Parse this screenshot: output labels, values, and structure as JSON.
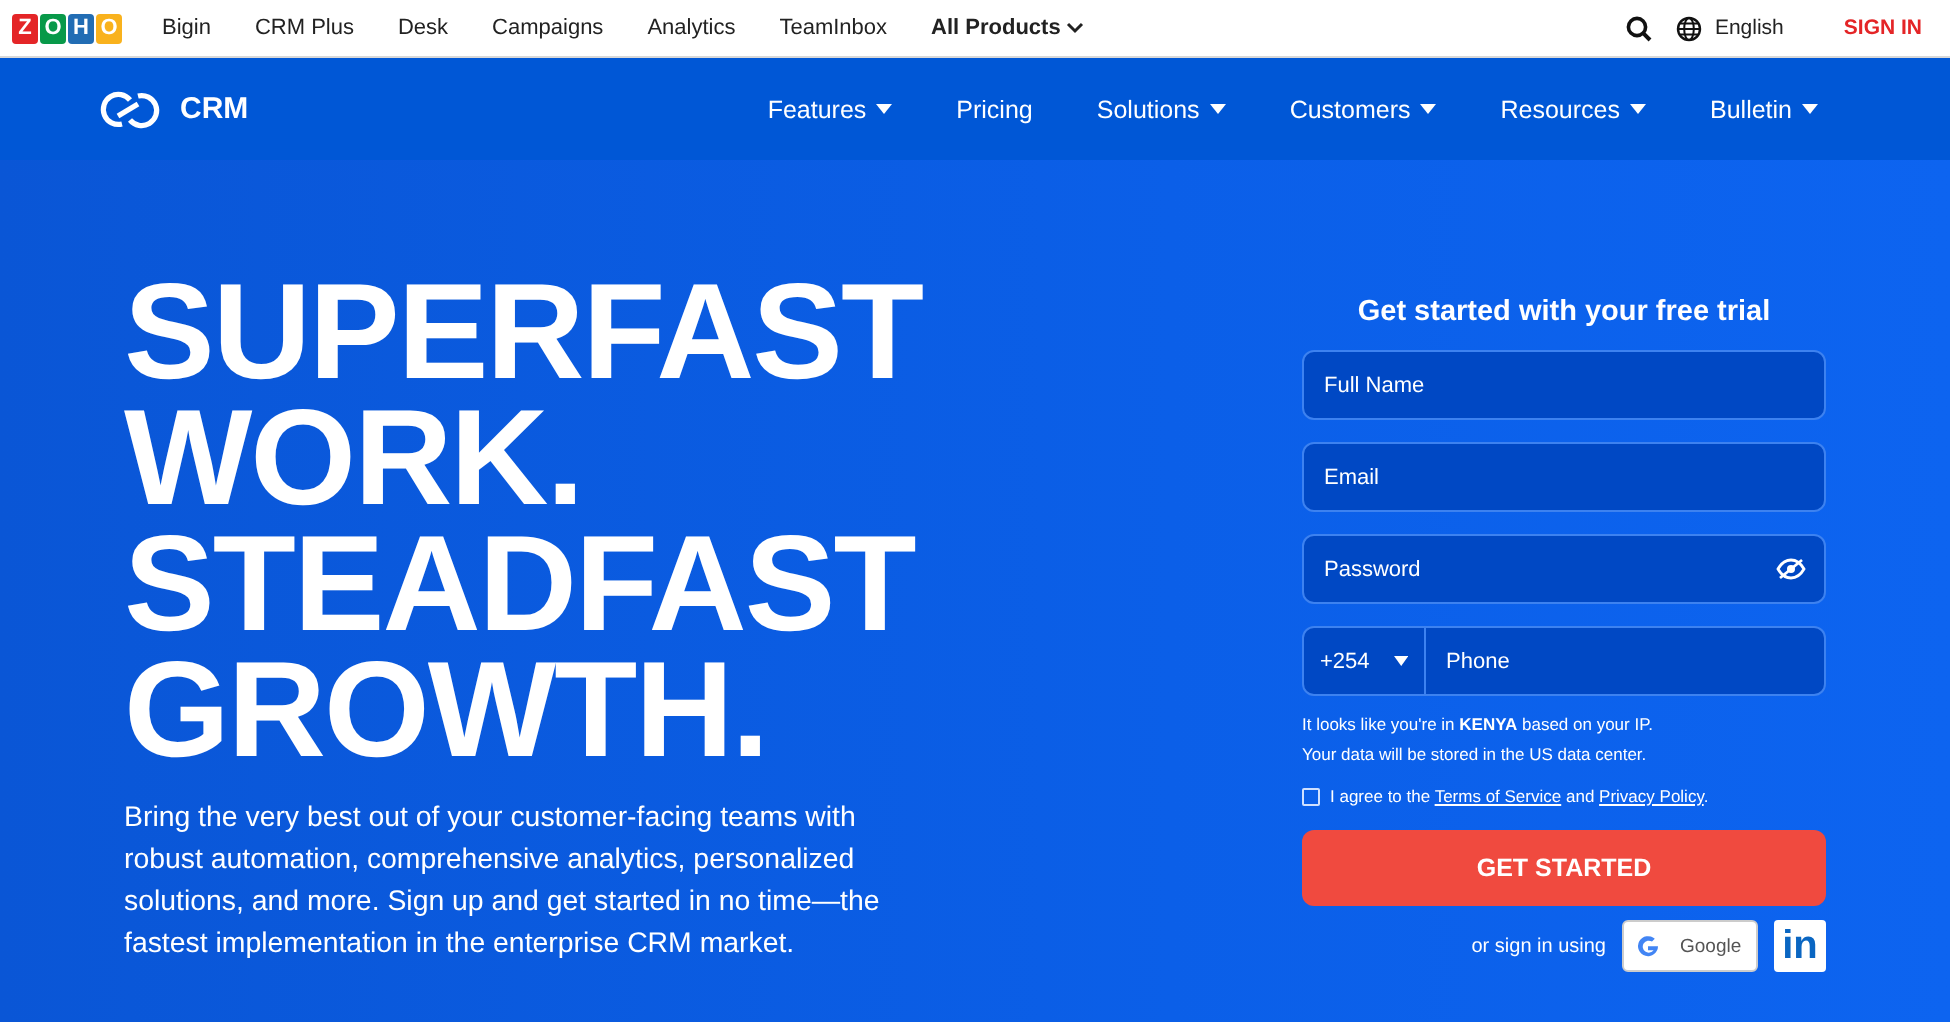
{
  "topbar": {
    "logo_letters": [
      "Z",
      "O",
      "H",
      "O"
    ],
    "links": [
      "Bigin",
      "CRM Plus",
      "Desk",
      "Campaigns",
      "Analytics",
      "TeamInbox"
    ],
    "all_products": "All Products",
    "language": "English",
    "sign_in": "SIGN IN"
  },
  "nav": {
    "brand": "CRM",
    "items": [
      {
        "label": "Features",
        "dropdown": true
      },
      {
        "label": "Pricing",
        "dropdown": false
      },
      {
        "label": "Solutions",
        "dropdown": true
      },
      {
        "label": "Customers",
        "dropdown": true
      },
      {
        "label": "Resources",
        "dropdown": true
      },
      {
        "label": "Bulletin",
        "dropdown": true
      }
    ]
  },
  "hero": {
    "headline": [
      "SUPERFAST",
      "WORK.",
      "STEADFAST",
      "GROWTH."
    ],
    "text": "Bring the very best out of your customer-facing teams with robust automation, comprehensive analytics, personalized solutions, and more. Sign up and get started in no time—the fastest implementation in the enterprise CRM market."
  },
  "form": {
    "title": "Get started with your free trial",
    "fields": [
      {
        "placeholder": "Full Name",
        "kind": "text"
      },
      {
        "placeholder": "Email",
        "kind": "text"
      },
      {
        "placeholder": "Password",
        "kind": "password"
      }
    ],
    "phone": {
      "code": "+254",
      "placeholder": "Phone"
    },
    "notes": [
      "It looks like you're in **KENYA** based on your IP.",
      "Your data will be stored in the US data center."
    ],
    "agree": {
      "checked": false,
      "before": "I agree to the",
      "terms": "Terms of Service",
      "middle": "and",
      "privacy": "Privacy Policy",
      "after": "."
    },
    "submit": "GET STARTED",
    "alt_label": "or sign in using",
    "google": "Google",
    "linkedin": "in"
  }
}
